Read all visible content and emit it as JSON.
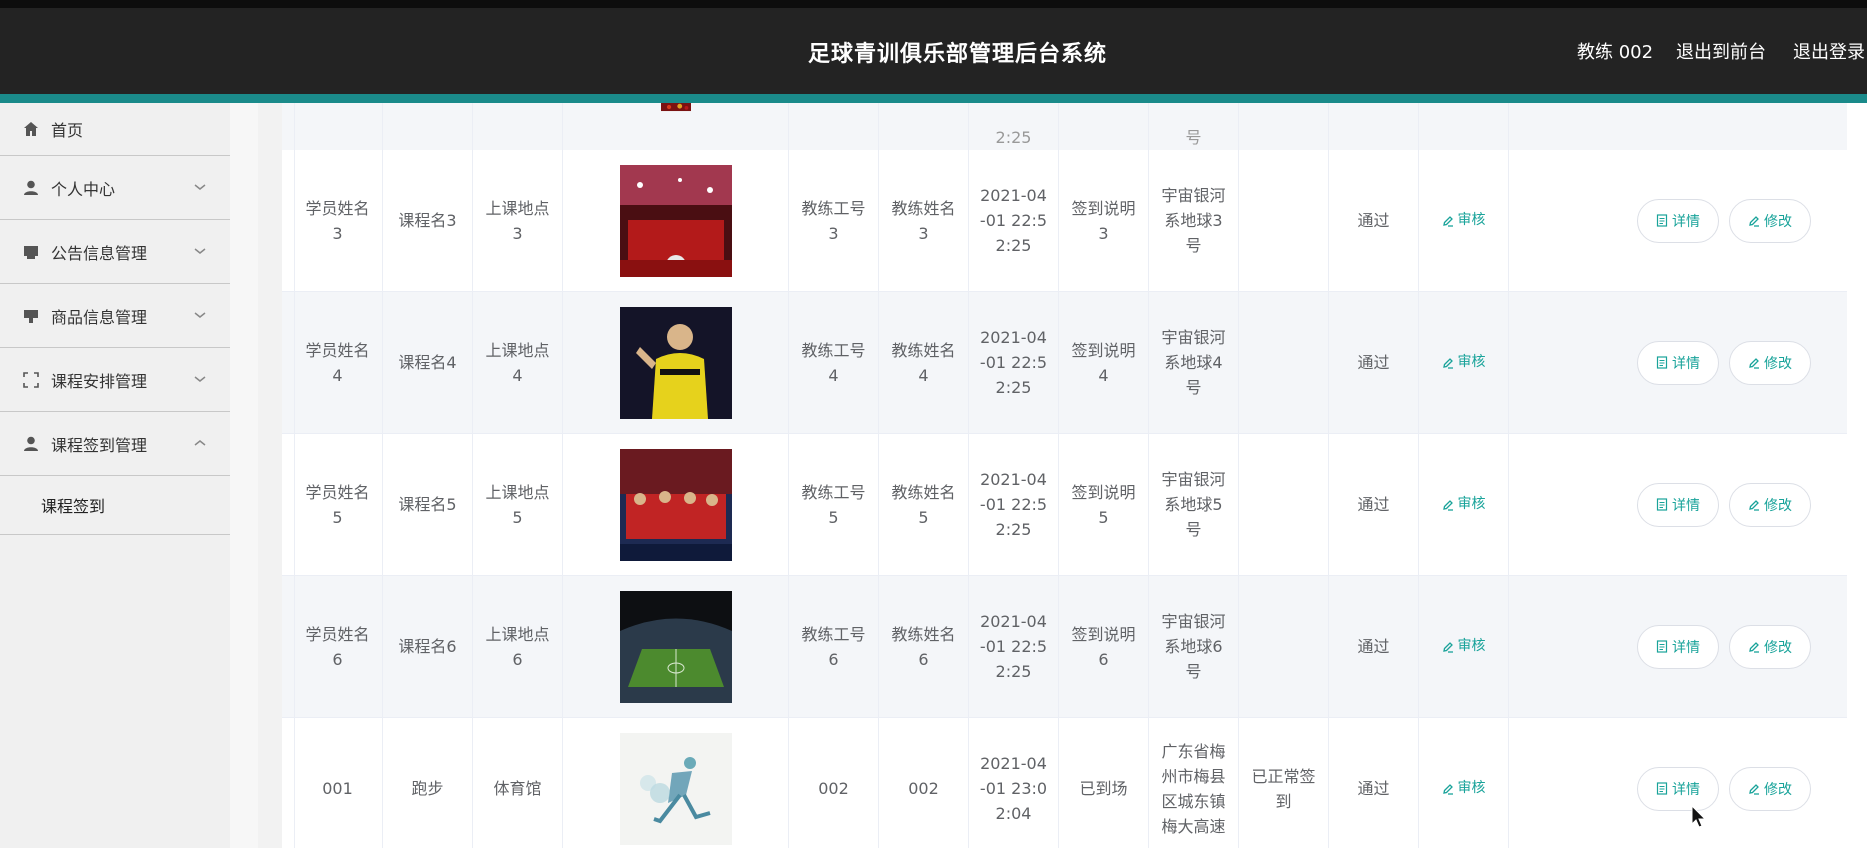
{
  "header": {
    "title": "足球青训俱乐部管理后台系统",
    "user": "教练 002",
    "to_front": "退出到前台",
    "logout": "退出登录"
  },
  "sidebar": {
    "items": [
      {
        "label": "首页",
        "icon": "home-icon"
      },
      {
        "label": "个人中心",
        "icon": "user-icon"
      },
      {
        "label": "公告信息管理",
        "icon": "notice-icon"
      },
      {
        "label": "商品信息管理",
        "icon": "goods-icon"
      },
      {
        "label": "课程安排管理",
        "icon": "schedule-icon"
      },
      {
        "label": "课程签到管理",
        "icon": "user-icon"
      }
    ],
    "sub_item": "课程签到"
  },
  "table": {
    "rows": [
      {
        "student": "学员姓名\n3",
        "course": "课程名3",
        "place": "上课地点\n3",
        "image": "trophy-celebration",
        "coach_no": "教练工号\n3",
        "coach_name": "教练姓名\n3",
        "time": "2021-04\n-01 22:5\n2:25",
        "sign": "签到说明\n3",
        "address": "宇宙银河\n系地球3\n号",
        "remark": "",
        "status": "通过",
        "audit": "审核",
        "detail": "详情",
        "edit": "修改"
      },
      {
        "student": "学员姓名\n4",
        "course": "课程名4",
        "place": "上课地点\n4",
        "image": "player-yellow-kit",
        "coach_no": "教练工号\n4",
        "coach_name": "教练姓名\n4",
        "time": "2021-04\n-01 22:5\n2:25",
        "sign": "签到说明\n4",
        "address": "宇宙银河\n系地球4\n号",
        "remark": "",
        "status": "通过",
        "audit": "审核",
        "detail": "详情",
        "edit": "修改"
      },
      {
        "student": "学员姓名\n5",
        "course": "课程名5",
        "place": "上课地点\n5",
        "image": "team-celebration",
        "coach_no": "教练工号\n5",
        "coach_name": "教练姓名\n5",
        "time": "2021-04\n-01 22:5\n2:25",
        "sign": "签到说明\n5",
        "address": "宇宙银河\n系地球5\n号",
        "remark": "",
        "status": "通过",
        "audit": "审核",
        "detail": "详情",
        "edit": "修改"
      },
      {
        "student": "学员姓名\n6",
        "course": "课程名6",
        "place": "上课地点\n6",
        "image": "stadium",
        "coach_no": "教练工号\n6",
        "coach_name": "教练姓名\n6",
        "time": "2021-04\n-01 22:5\n2:25",
        "sign": "签到说明\n6",
        "address": "宇宙银河\n系地球6\n号",
        "remark": "",
        "status": "通过",
        "audit": "审核",
        "detail": "详情",
        "edit": "修改"
      },
      {
        "student": "001",
        "course": "跑步",
        "place": "体育馆",
        "image": "runner-sketch",
        "coach_no": "002",
        "coach_name": "002",
        "time": "2021-04\n-01 23:0\n2:04",
        "sign": "已到场",
        "address": "广东省梅\n州市梅县\n区城东镇\n梅大高速",
        "remark": "已正常签\n到",
        "status": "通过",
        "audit": "审核",
        "detail": "详情",
        "edit": "修改"
      }
    ]
  },
  "colors": {
    "header_bg": "#232323",
    "accent_teal": "#1a8a8a",
    "link_teal": "#19a39a",
    "sidebar_bg": "#f0f0f0"
  }
}
